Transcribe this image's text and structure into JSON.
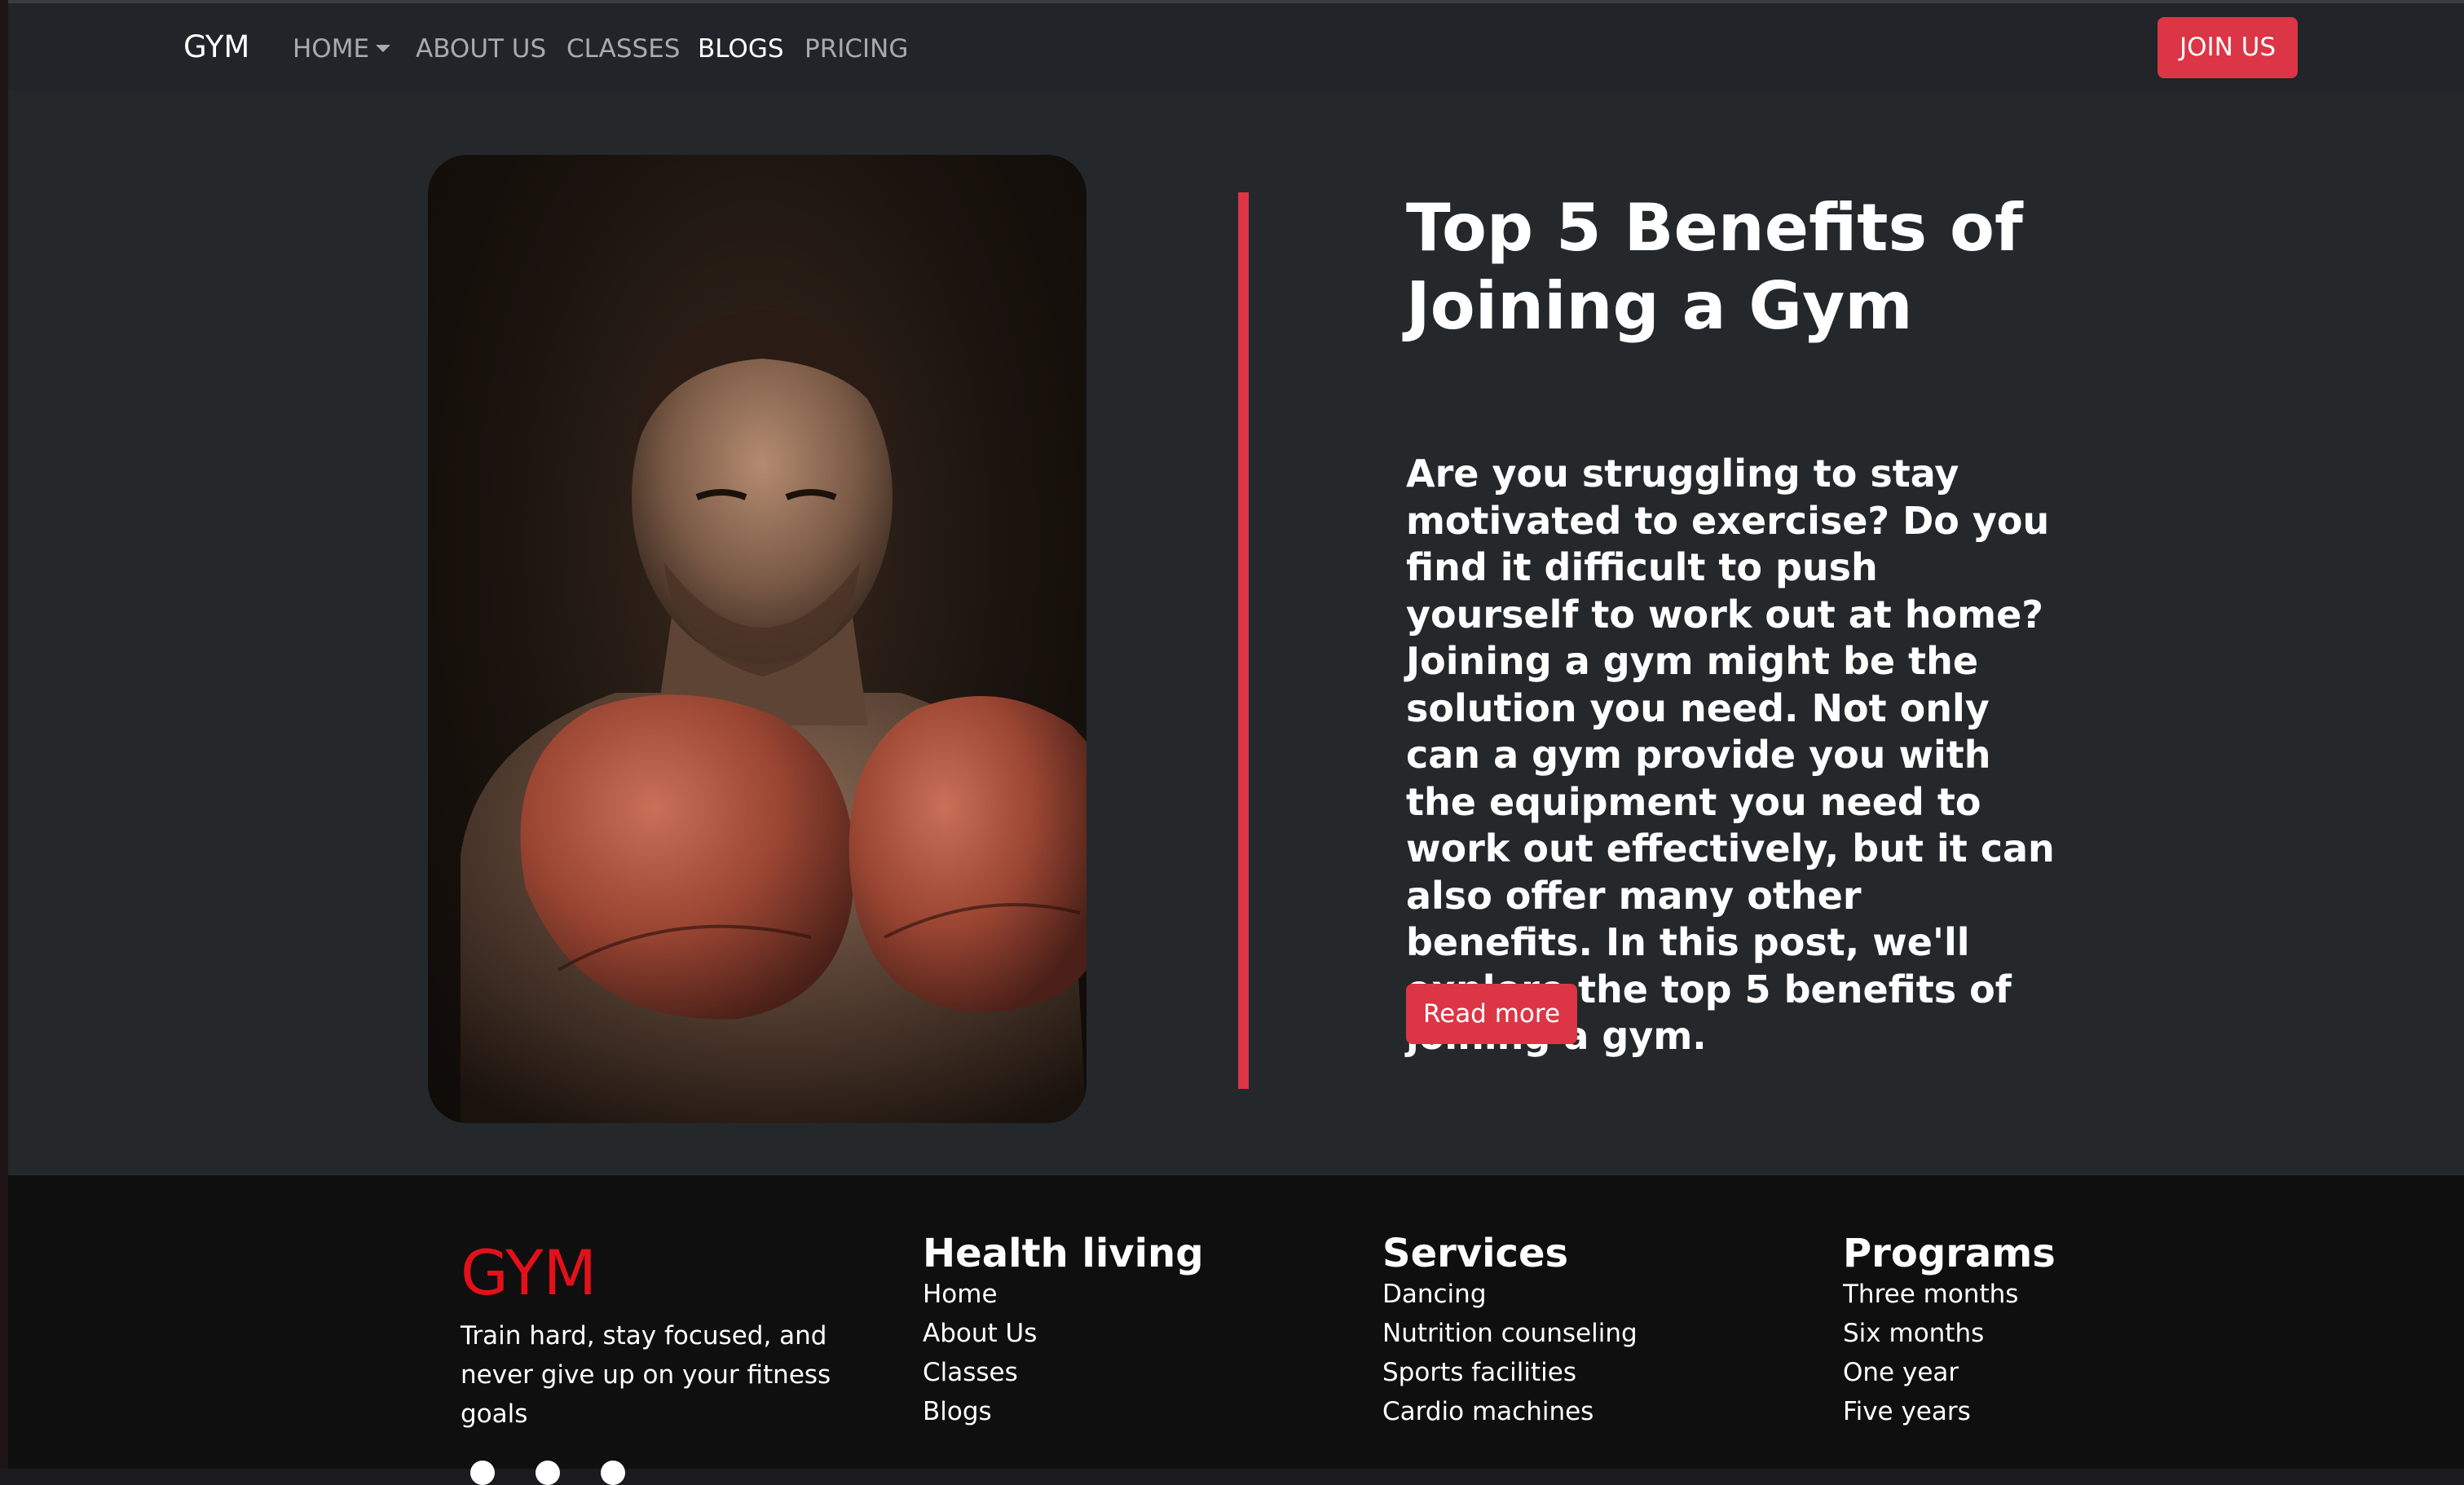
{
  "nav": {
    "brand": "GYM",
    "items": [
      {
        "label": "HOME",
        "has_dropdown": true
      },
      {
        "label": "ABOUT US"
      },
      {
        "label": "CLASSES"
      },
      {
        "label": "BLOGS",
        "active": true
      },
      {
        "label": "PRICING"
      }
    ],
    "cta_label": "JOIN US"
  },
  "post": {
    "title": "Top 5 Benefits of Joining a Gym",
    "body": "Are you struggling to stay motivated to exercise? Do you find it difficult to push yourself to work out at home? Joining a gym might be the solution you need. Not only can a gym provide you with the equipment you need to work out effectively, but it can also offer many other benefits. In this post, we'll explore the top 5 benefits of joining a gym.",
    "read_more_label": "Read more"
  },
  "footer": {
    "logo": "GYM",
    "tagline": "Train hard, stay focused, and never give up on your fitness goals",
    "columns": [
      {
        "title": "Health living",
        "links": [
          "Home",
          "About Us",
          "Classes",
          "Blogs"
        ]
      },
      {
        "title": "Services",
        "links": [
          "Dancing",
          "Nutrition counseling",
          "Sports facilities",
          "Cardio machines"
        ]
      },
      {
        "title": "Programs",
        "links": [
          "Three months",
          "Six months",
          "One year",
          "Five years"
        ]
      }
    ]
  },
  "colors": {
    "accent": "#dc3545",
    "logo_red": "#e3101a",
    "navbar_bg": "#212428",
    "page_bg": "#24282b",
    "footer_bg": "#0f0f0f"
  },
  "icons": {
    "hero_image": "boxer-with-red-gloves-photo",
    "social": [
      "social-icon-1",
      "social-icon-2",
      "social-icon-3"
    ]
  }
}
